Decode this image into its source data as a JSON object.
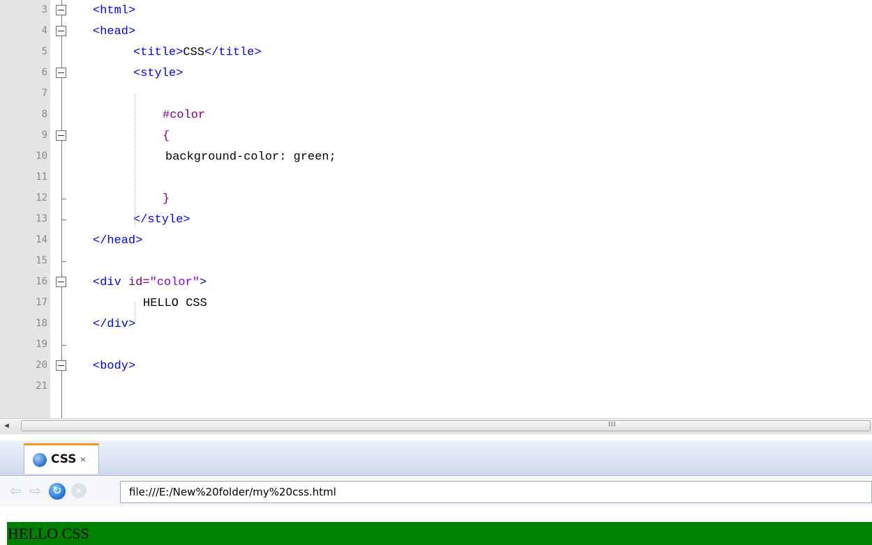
{
  "editor": {
    "lines": [
      {
        "num": "3",
        "parts": [
          {
            "cls": "tag",
            "text": "<html>"
          }
        ]
      },
      {
        "num": "4",
        "parts": [
          {
            "cls": "tag",
            "text": "<head>"
          }
        ]
      },
      {
        "num": "5",
        "parts": [
          {
            "cls": "tag",
            "text": "<title>"
          },
          {
            "cls": "txt",
            "text": "CSS"
          },
          {
            "cls": "tag",
            "text": "</title>"
          }
        ]
      },
      {
        "num": "6",
        "parts": [
          {
            "cls": "tag",
            "text": "<style>"
          }
        ]
      },
      {
        "num": "7",
        "parts": []
      },
      {
        "num": "8",
        "parts": [
          {
            "cls": "sel",
            "text": "#color"
          }
        ]
      },
      {
        "num": "9",
        "parts": [
          {
            "cls": "sel",
            "text": "{"
          }
        ]
      },
      {
        "num": "10",
        "parts": [
          {
            "cls": "txt",
            "text": "background-color: green;"
          }
        ]
      },
      {
        "num": "11",
        "parts": []
      },
      {
        "num": "12",
        "parts": [
          {
            "cls": "sel",
            "text": "}"
          }
        ]
      },
      {
        "num": "13",
        "parts": [
          {
            "cls": "tag",
            "text": "</style>"
          }
        ]
      },
      {
        "num": "14",
        "parts": [
          {
            "cls": "tag",
            "text": "</head>"
          }
        ]
      },
      {
        "num": "15",
        "parts": []
      },
      {
        "num": "16",
        "parts": [
          {
            "cls": "tag",
            "text": "<div "
          },
          {
            "cls": "attr",
            "text": "id="
          },
          {
            "cls": "str",
            "text": "\"color\""
          },
          {
            "cls": "tag",
            "text": ">"
          }
        ]
      },
      {
        "num": "17",
        "parts": [
          {
            "cls": "txt",
            "text": "HELLO CSS"
          }
        ]
      },
      {
        "num": "18",
        "parts": [
          {
            "cls": "tag",
            "text": "</div>"
          }
        ]
      },
      {
        "num": "19",
        "parts": []
      },
      {
        "num": "20",
        "parts": [
          {
            "cls": "tag",
            "text": "<body>"
          }
        ]
      },
      {
        "num": "21",
        "parts": []
      }
    ]
  },
  "scrollbar": {
    "left_arrow": "◄",
    "grip": "III"
  },
  "browser": {
    "tab_label": "CSS",
    "tab_close": "×",
    "back_icon": "⇦",
    "forward_icon": "⇨",
    "reload_icon": "↻",
    "stop_icon": "×",
    "url": "file:///E:/New%20folder/my%20css.html",
    "page_text": "HELLO CSS",
    "page_bg_color": "#008000"
  }
}
